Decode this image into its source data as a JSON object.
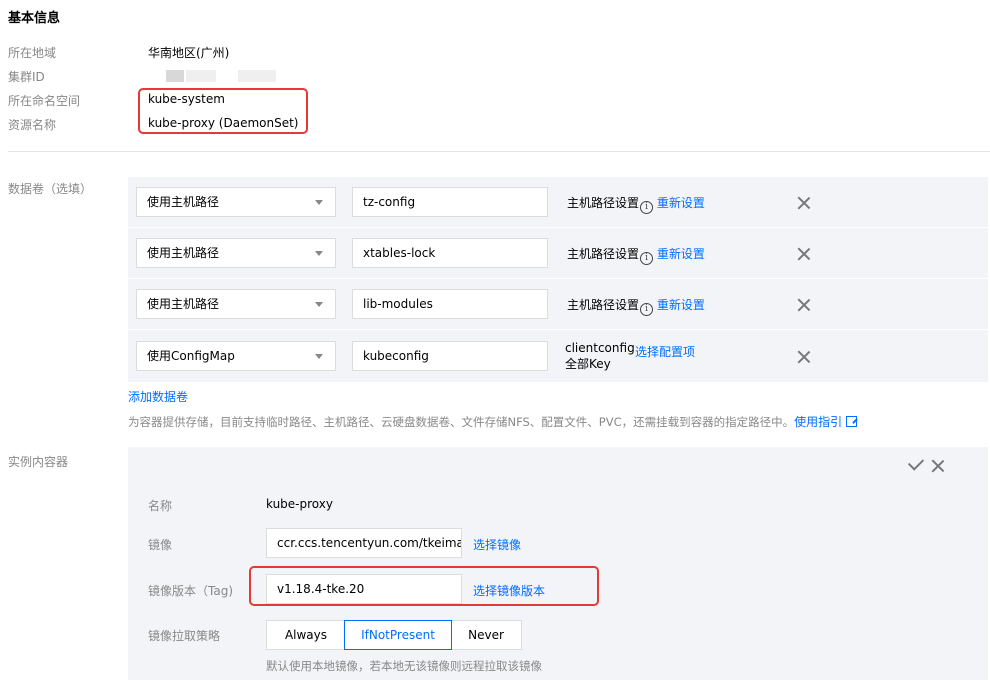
{
  "basic": {
    "title": "基本信息",
    "region_label": "所在地域",
    "region_value": "华南地区(广州)",
    "cluster_label": "集群ID",
    "namespace_label": "所在命名空间",
    "namespace_value": "kube-system",
    "resource_label": "资源名称",
    "resource_value": "kube-proxy (DaemonSet)"
  },
  "volumes": {
    "label": "数据卷（选填）",
    "rows": [
      {
        "type": "使用主机路径",
        "name": "tz-config",
        "setting": "主机路径设置",
        "action": "重新设置"
      },
      {
        "type": "使用主机路径",
        "name": "xtables-lock",
        "setting": "主机路径设置",
        "action": "重新设置"
      },
      {
        "type": "使用主机路径",
        "name": "lib-modules",
        "setting": "主机路径设置",
        "action": "重新设置"
      },
      {
        "type": "使用ConfigMap",
        "name": "kubeconfig",
        "setting": "clientconfig",
        "setting_sub": "全部Key",
        "action": "选择配置项"
      }
    ],
    "add_label": "添加数据卷",
    "help_text": "为容器提供存储，目前支持临时路径、主机路径、云硬盘数据卷、文件存储NFS、配置文件、PVC，还需挂载到容器的指定路径中。",
    "help_link": "使用指引"
  },
  "containers": {
    "label": "实例内容器",
    "name_label": "名称",
    "name_value": "kube-proxy",
    "image_label": "镜像",
    "image_value": "ccr.ccs.tencentyun.com/tkeimage",
    "image_link": "选择镜像",
    "tag_label": "镜像版本（Tag)",
    "tag_value": "v1.18.4-tke.20",
    "tag_link": "选择镜像版本",
    "pull_label": "镜像拉取策略",
    "pull_options": [
      "Always",
      "IfNotPresent",
      "Never"
    ],
    "pull_selected": "IfNotPresent",
    "pull_hint": "默认使用本地镜像，若本地无该镜像则远程拉取该镜像"
  }
}
